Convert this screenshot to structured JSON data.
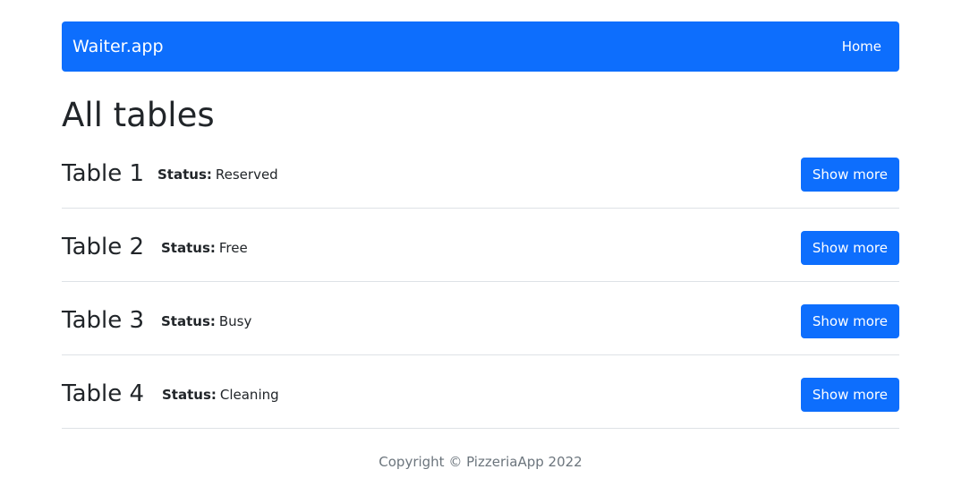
{
  "navbar": {
    "brand": "Waiter.app",
    "home_link": "Home"
  },
  "page": {
    "title": "All tables"
  },
  "tables": [
    {
      "name": "Table 1",
      "status_label": "Status:",
      "status": "Reserved",
      "button_label": "Show more"
    },
    {
      "name": "Table 2",
      "status_label": "Status:",
      "status": "Free",
      "button_label": "Show more"
    },
    {
      "name": "Table 3",
      "status_label": "Status:",
      "status": "Busy",
      "button_label": "Show more"
    },
    {
      "name": "Table 4",
      "status_label": "Status:",
      "status": "Cleaning",
      "button_label": "Show more"
    }
  ],
  "footer": {
    "copyright": "Copyright © PizzeriaApp 2022"
  },
  "colors": {
    "primary": "#0d6efd",
    "text": "#212529",
    "muted": "#6c757d",
    "divider": "#dee2e6"
  }
}
